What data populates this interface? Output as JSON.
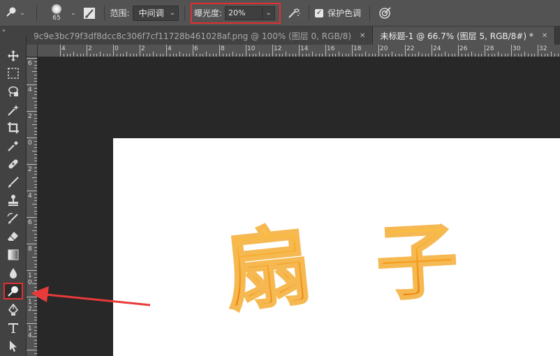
{
  "options_bar": {
    "brush_size": "65",
    "range_label": "范围:",
    "range_value": "中间调",
    "exposure_label": "曝光度:",
    "exposure_value": "20%",
    "protect_tones_label": "保护色调",
    "protect_tones_checked": true
  },
  "toolbar": {
    "collapse_glyph": "»",
    "selected_tool": "dodge-tool",
    "tools": [
      "move",
      "marquee",
      "lasso",
      "quick-select",
      "crop",
      "eyedropper",
      "healing",
      "brush",
      "clone-stamp",
      "history-brush",
      "eraser",
      "gradient",
      "blur",
      "dodge",
      "pen",
      "type",
      "path-select"
    ]
  },
  "tabs": [
    {
      "label": "9c9e3bc79f3df8dcc8c306f7cf11728b461028af.png @ 100% (图层 0, RGB/8)",
      "active": false
    },
    {
      "label": "未标题-1 @ 66.7% (图层 5, RGB/8#) *",
      "active": true
    }
  ],
  "ruler_h_labels": [
    "4",
    "2",
    "0",
    "2",
    "4",
    "6",
    "8",
    "10",
    "12",
    "14",
    "16",
    "18",
    "20",
    "22",
    "24",
    "26",
    "28",
    "30",
    "32"
  ],
  "ruler_v_labels": [
    "6",
    "4",
    "2",
    "0",
    "2",
    "4",
    "6",
    "8",
    "10",
    "12",
    "14"
  ],
  "artwork_text": "扇 子",
  "colors": {
    "accent_highlight": "#e03030",
    "panel": "#535353",
    "toolbar": "#424242",
    "pasteboard": "#282828",
    "document": "#ffffff",
    "text_fill": "#f59a1b"
  }
}
